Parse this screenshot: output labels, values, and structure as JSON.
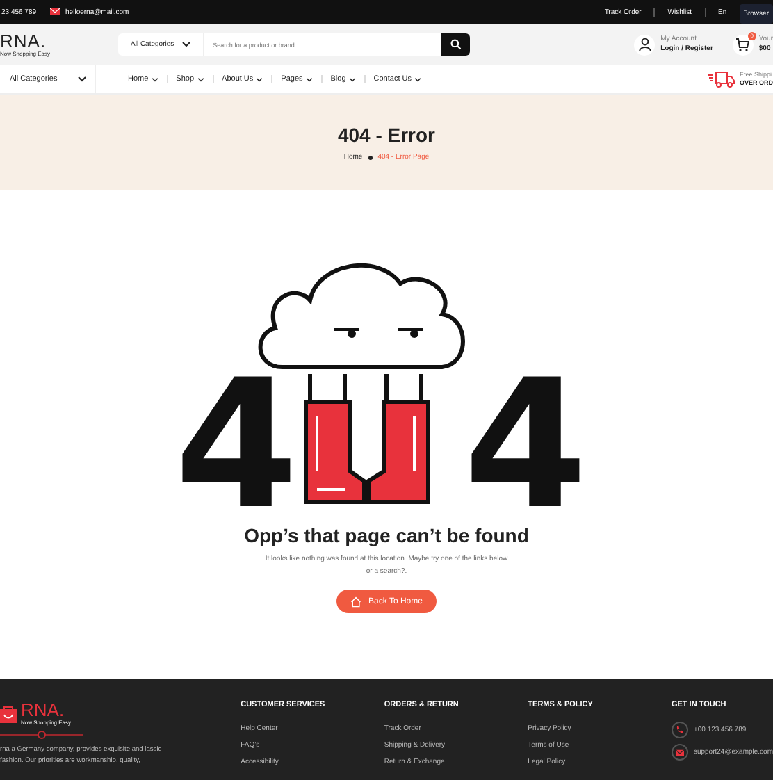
{
  "top_bar": {
    "phone": "23 456 789",
    "email": "helloerna@mail.com",
    "links": [
      "Track Order",
      "Wishlist",
      "En"
    ],
    "badge": "Browser"
  },
  "header": {
    "logo": "RNA.",
    "tagline": "Now Shopping Easy",
    "category_select": "All Categories",
    "search_placeholder": "Search for a product or brand...",
    "account_label": "My Account",
    "account_link": "Login / Register",
    "cart_count": "0",
    "cart_label": "Your",
    "cart_total": "$00"
  },
  "nav": {
    "categories": "All Categories",
    "items": [
      "Home",
      "Shop",
      "About Us",
      "Pages",
      "Blog",
      "Contact Us"
    ],
    "shipping_label": "Free Shippi",
    "shipping_value": "OVER ORD"
  },
  "hero": {
    "title": "404 - Error",
    "breadcrumb": [
      {
        "label": "Home",
        "selected": false
      },
      {
        "label": "404 - Error Page",
        "selected": true
      }
    ]
  },
  "error": {
    "digits": [
      "4",
      "4"
    ],
    "heading": "Opp’s that page can’t be found",
    "message": "It looks like nothing was found at this location. Maybe try one of the links below or a search?.",
    "button": "Back To Home"
  },
  "footer": {
    "logo": "RNA.",
    "tagline": "Now Shopping Easy",
    "about": "rna a Germany company, provides exquisite and lassic fashion. Our priorities are workmanship, quality,",
    "columns": [
      {
        "title": "CUSTOMER SERVICES",
        "links": [
          "Help Center",
          "FAQ’s",
          "Accessibility"
        ]
      },
      {
        "title": "ORDERS & RETURN",
        "links": [
          "Track Order",
          "Shipping & Delivery",
          "Return & Exchange"
        ]
      },
      {
        "title": "TERMS & POLICY",
        "links": [
          "Privacy Policy",
          "Terms of Use",
          "Legal Policy"
        ]
      }
    ],
    "contact_title": "GET IN TOUCH",
    "contacts": [
      {
        "kind": "phone",
        "text": "+00 123 456 789"
      },
      {
        "kind": "email",
        "text": "support24@example.com"
      }
    ]
  }
}
